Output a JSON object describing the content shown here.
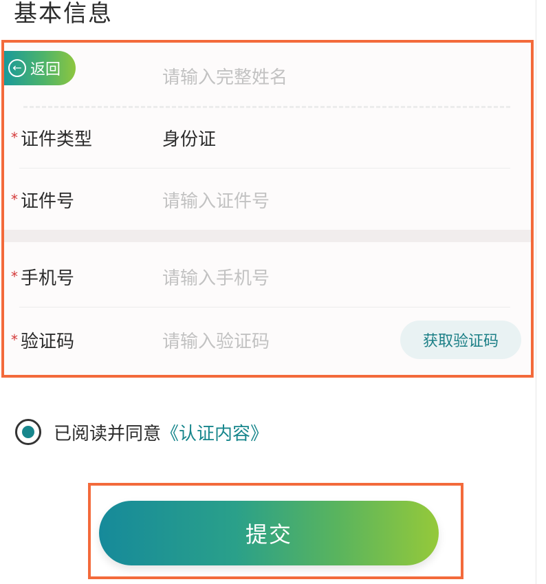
{
  "page": {
    "title": "基本信息"
  },
  "form": {
    "back_label": "返回",
    "name": {
      "placeholder": "请输入完整姓名"
    },
    "id_type": {
      "label": "证件类型",
      "value": "身份证"
    },
    "id_number": {
      "label": "证件号",
      "placeholder": "请输入证件号"
    },
    "phone": {
      "label": "手机号",
      "placeholder": "请输入手机号"
    },
    "verify_code": {
      "label": "验证码",
      "placeholder": "请输入验证码",
      "button_label": "获取验证码"
    },
    "required_mark": "*"
  },
  "agreement": {
    "text": "已阅读并同意",
    "link": "《认证内容》",
    "checked": true
  },
  "submit": {
    "label": "提交"
  },
  "colors": {
    "accent": "#17868c",
    "highlight_border": "#f36a3b",
    "required": "#d43a3a"
  }
}
